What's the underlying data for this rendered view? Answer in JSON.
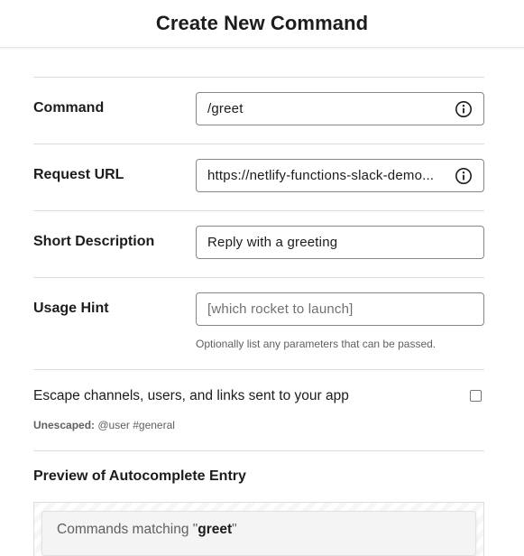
{
  "header": {
    "title": "Create New Command"
  },
  "form": {
    "command": {
      "label": "Command",
      "value": "/greet",
      "icon": "info-icon"
    },
    "request_url": {
      "label": "Request URL",
      "value": "https://netlify-functions-slack-demo...",
      "icon": "info-icon"
    },
    "short_description": {
      "label": "Short Description",
      "value": "Reply with a greeting"
    },
    "usage_hint": {
      "label": "Usage Hint",
      "placeholder": "[which rocket to launch]",
      "help": "Optionally list any parameters that can be passed."
    },
    "escape": {
      "label": "Escape channels, users, and links sent to your app",
      "checked": false,
      "unescaped_label": "Unescaped:",
      "unescaped_example": "@user #general"
    }
  },
  "preview": {
    "title": "Preview of Autocomplete Entry",
    "matching_prefix": "Commands matching \"",
    "matching_term": "greet",
    "matching_suffix": "\""
  }
}
